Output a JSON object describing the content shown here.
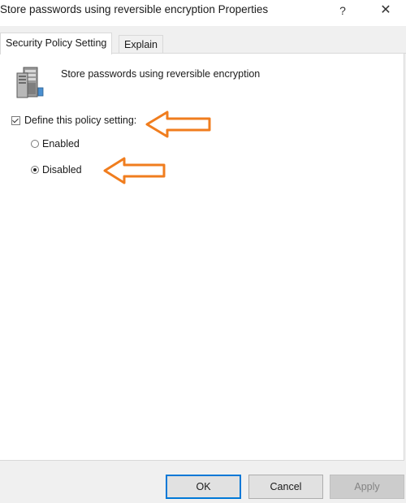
{
  "window": {
    "title": "Store passwords using reversible encryption Properties",
    "help_glyph": "?",
    "close_glyph": "✕"
  },
  "tabs": [
    {
      "label": "Security Policy Setting",
      "active": true
    },
    {
      "label": "Explain",
      "active": false
    }
  ],
  "policy": {
    "icon": "server-icon",
    "name": "Store passwords using reversible encryption"
  },
  "define_setting": {
    "label": "Define this policy setting:",
    "checked": true
  },
  "options": [
    {
      "label": "Enabled",
      "selected": false
    },
    {
      "label": "Disabled",
      "selected": true
    }
  ],
  "annotations": {
    "arrow_color": "#f07d1e"
  },
  "buttons": {
    "ok": "OK",
    "cancel": "Cancel",
    "apply": "Apply"
  }
}
